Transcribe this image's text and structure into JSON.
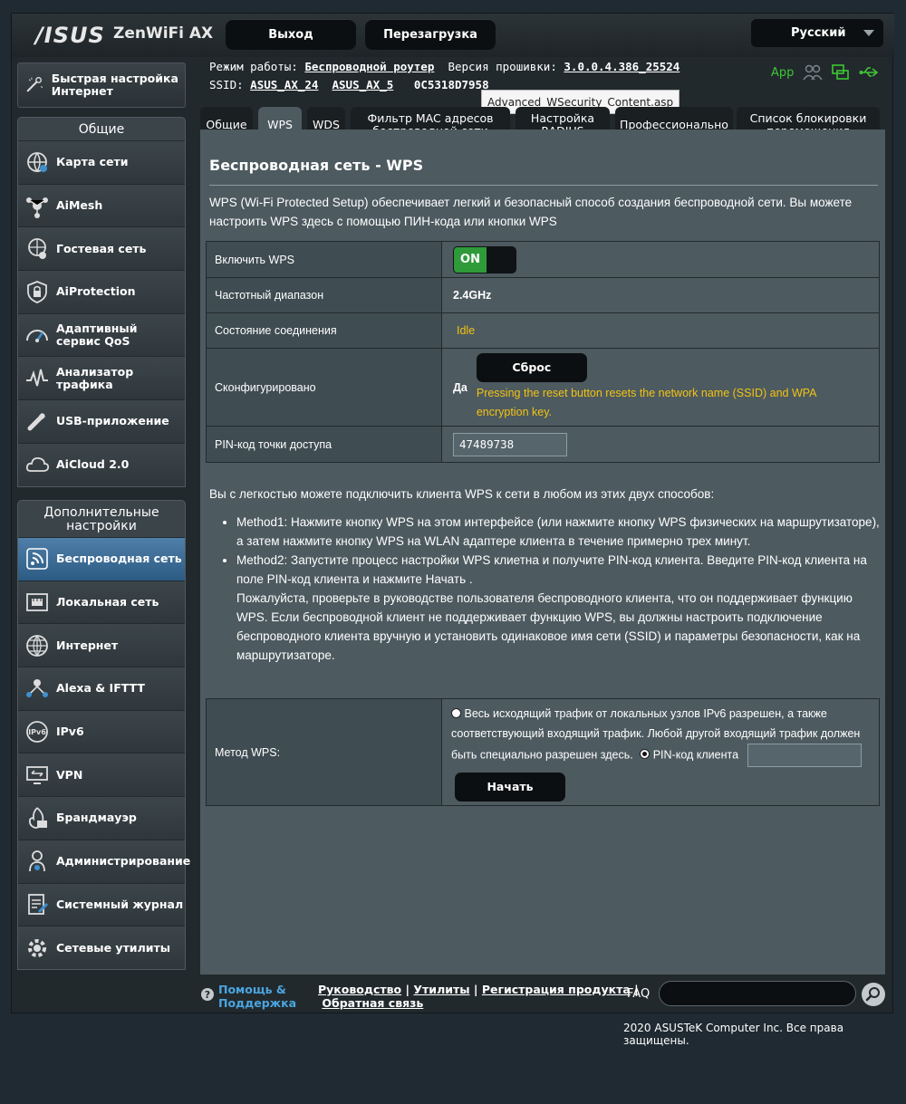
{
  "header": {
    "logo": "/ISUS",
    "product": "ZenWiFi AX",
    "logout_label": "Выход",
    "reboot_label": "Перезагрузка",
    "language": "Русский"
  },
  "info": {
    "mode_label": "Режим работы:",
    "mode_value": "Беспроводной роутер",
    "firmware_label": "Версия прошивки:",
    "firmware_value": "3.0.0.4.386_25524",
    "ssid_label": "SSID:",
    "ssid_24": "ASUS_AX_24",
    "ssid_5": "ASUS_AX_5",
    "mac": "0C5318D7958",
    "tooltip": "Advanced_WSecurity_Content.asp",
    "app_label": "App"
  },
  "sidebar": {
    "quick_setup": "Быстрая настройка Интернет",
    "general_title": "Общие",
    "general_items": [
      {
        "label": "Карта сети",
        "icon": "globe-map-icon"
      },
      {
        "label": "AiMesh",
        "icon": "aimesh-icon"
      },
      {
        "label": "Гостевая сеть",
        "icon": "guest-network-icon"
      },
      {
        "label": "AiProtection",
        "icon": "shield-lock-icon"
      },
      {
        "label": "Адаптивный сервис QoS",
        "icon": "gauge-icon"
      },
      {
        "label": "Анализатор трафика",
        "icon": "traffic-analyzer-icon"
      },
      {
        "label": "USB-приложение",
        "icon": "usb-icon"
      },
      {
        "label": "AiCloud 2.0",
        "icon": "cloud-icon"
      }
    ],
    "advanced_title": "Дополнительные настройки",
    "advanced_items": [
      {
        "label": "Беспроводная сеть",
        "icon": "wireless-icon",
        "active": true
      },
      {
        "label": "Локальная сеть",
        "icon": "lan-icon"
      },
      {
        "label": "Интернет",
        "icon": "internet-globe-icon"
      },
      {
        "label": "Alexa & IFTTT",
        "icon": "alexa-icon"
      },
      {
        "label": "IPv6",
        "icon": "ipv6-icon"
      },
      {
        "label": "VPN",
        "icon": "vpn-icon"
      },
      {
        "label": "Брандмауэр",
        "icon": "firewall-icon"
      },
      {
        "label": "Администрирование",
        "icon": "admin-gear-icon"
      },
      {
        "label": "Системный журнал",
        "icon": "system-log-icon"
      },
      {
        "label": "Сетевые утилиты",
        "icon": "network-tools-icon"
      }
    ]
  },
  "tabs": [
    {
      "label": "Общие"
    },
    {
      "label": "WPS",
      "active": true
    },
    {
      "label": "WDS"
    },
    {
      "label": "Фильтр MAC адресов беспроводной сети"
    },
    {
      "label": "Настройка RADIUS"
    },
    {
      "label": "Профессионально"
    },
    {
      "label": "Список блокировки перемещения"
    }
  ],
  "content": {
    "title": "Беспроводная сеть - WPS",
    "description": "WPS (Wi-Fi Protected Setup) обеспечивает легкий и безопасный способ создания беспроводной сети. Вы можете настроить WPS здесь с помощью ПИН-кода или кнопки WPS",
    "rows": {
      "enable_label": "Включить WPS",
      "enable_value": "ON",
      "band_label": "Частотный диапазон",
      "band_value": "2.4GHz",
      "status_label": "Состояние соединения",
      "status_value": "Idle",
      "configured_label": "Сконфигурировано",
      "configured_value": "Да",
      "reset_label": "Сброс",
      "reset_note": "Pressing the reset button resets the network name (SSID) and WPA encryption key.",
      "pin_label": "PIN-код точки доступа",
      "pin_value": "47489738"
    },
    "intro": "Вы с легкостью можете подключить клиента WPS к сети в любом из этих двух способов:",
    "method1": "Method1: Нажмите кнопку WPS на этом интерфейсе (или нажмите кнопку WPS физических на маршрутизаторе), а затем нажмите кнопку WPS на WLAN адаптере клиента в течение примерно трех минут.",
    "method2": "Method2: Запустите процесс настройки WPS клиетна и получите PIN-код клиента. Введите PIN-код клиента на поле PIN-код клиента и нажмите Начать .",
    "method2_note": "Пожалуйста, проверьте в руководстве пользователя беспроводного клиента, что он поддерживает функцию WPS. Если беспроводной клиент не поддерживает функцию WPS, вы должны настроить подключение беспроводного клиента вручную и установить одинаковое имя сети (SSID) и параметры безопасности, как на маршрутизаторе.",
    "method_label": "Метод WPS:",
    "radio1_text": "Весь исходящий трафик от локальных узлов IPv6 разрешен, а также соответствующий входящий трафик. Любой другой входящий трафик должен быть специально разрешен здесь.",
    "radio2_text": "PIN-код клиента",
    "start_label": "Начать"
  },
  "footer": {
    "help_label": "Помощь & Поддержка",
    "link_manual": "Руководство",
    "link_utils": "Утилиты",
    "link_register": "Регистрация продукта",
    "link_feedback": "Обратная связь",
    "faq_label": "FAQ",
    "copyright": "2020 ASUSTeK Computer Inc. Все права защищены."
  }
}
